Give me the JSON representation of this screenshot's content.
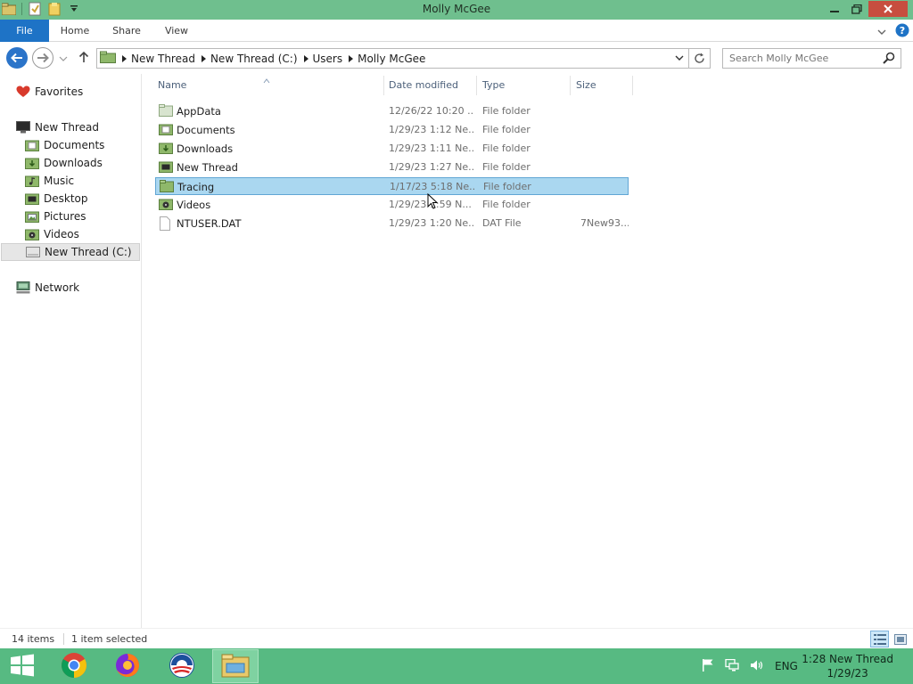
{
  "window": {
    "title": "Molly McGee"
  },
  "ribbon": {
    "tabs": [
      {
        "label": "File"
      },
      {
        "label": "Home"
      },
      {
        "label": "Share"
      },
      {
        "label": "View"
      }
    ]
  },
  "address": {
    "breadcrumbs": [
      {
        "label": "New Thread"
      },
      {
        "label": "New Thread (C:)"
      },
      {
        "label": "Users"
      },
      {
        "label": "Molly McGee"
      }
    ]
  },
  "search": {
    "placeholder": "Search Molly McGee"
  },
  "sidebar": {
    "favorites": "Favorites",
    "items": [
      {
        "label": "New Thread",
        "icon": "pc-icon"
      },
      {
        "label": "Documents",
        "icon": "documents-folder-icon"
      },
      {
        "label": "Downloads",
        "icon": "downloads-folder-icon"
      },
      {
        "label": "Music",
        "icon": "music-folder-icon"
      },
      {
        "label": "Desktop",
        "icon": "desktop-folder-icon"
      },
      {
        "label": "Pictures",
        "icon": "pictures-folder-icon"
      },
      {
        "label": "Videos",
        "icon": "videos-folder-icon"
      },
      {
        "label": "New Thread (C:)",
        "icon": "drive-icon"
      }
    ],
    "network": "Network"
  },
  "columns": {
    "name": "Name",
    "date": "Date modified",
    "type": "Type",
    "size": "Size"
  },
  "files": [
    {
      "name": "AppData",
      "date": "12/26/22 10:20 ...",
      "type": "File folder",
      "size": "",
      "icon": "folder-icon"
    },
    {
      "name": "Documents",
      "date": "1/29/23 1:12 Ne...",
      "type": "File folder",
      "size": "",
      "icon": "documents-folder-icon"
    },
    {
      "name": "Downloads",
      "date": "1/29/23 1:11 Ne...",
      "type": "File folder",
      "size": "",
      "icon": "downloads-folder-icon"
    },
    {
      "name": "New Thread",
      "date": "1/29/23 1:27 Ne...",
      "type": "File folder",
      "size": "",
      "icon": "desktop-folder-icon"
    },
    {
      "name": "Tracing",
      "date": "1/17/23 5:18 Ne...",
      "type": "File folder",
      "size": "",
      "icon": "folder-icon",
      "selected": true
    },
    {
      "name": "Videos",
      "date": "1/29/23 1:59 N...",
      "type": "File folder",
      "size": "",
      "icon": "videos-folder-icon"
    },
    {
      "name": "NTUSER.DAT",
      "date": "1/29/23 1:20 Ne...",
      "type": "DAT File",
      "size": "7New93...",
      "icon": "file-icon"
    }
  ],
  "status": {
    "items": "14 items",
    "selected": "1 item selected"
  },
  "taskbar": {
    "apps": [
      "start-icon",
      "chrome-icon",
      "firefox-icon",
      "obama-logo-icon",
      "file-explorer-icon"
    ],
    "lang": "ENG",
    "time": "1:28 New Thread",
    "date": "1/29/23"
  },
  "colors": {
    "titlebar": "#6fbf8e",
    "taskbar": "#57ba82",
    "accent": "#1e73c6",
    "selection": "#aad7f0"
  }
}
